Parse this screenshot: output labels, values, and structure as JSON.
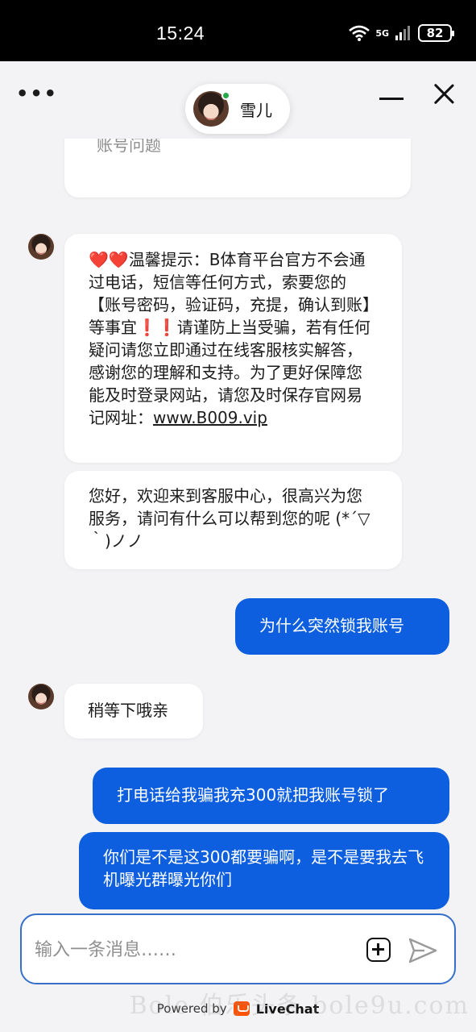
{
  "status_bar": {
    "time": "15:24",
    "network": "5G",
    "battery": "82"
  },
  "header": {
    "agent_name": "雪儿",
    "menu_icon": "more-horizontal-icon",
    "minimize_icon": "minimize-icon",
    "close_icon": "close-icon"
  },
  "chat": {
    "previous_card_text": "账号问题",
    "messages": [
      {
        "from": "agent",
        "parts": {
          "heart": "❤️❤️",
          "lines": "温馨提示：B体育平台官方不会通过电话，短信等任何方式，索要您的【账号密码，验证码，充提，确认到账】等事宜❗❗请谨防上当受骗，若有任何疑问请您立即通过在线客服核实解答，感谢您的理解和支持。为了更好保障您能及时登录网站，请您及时保存官网易记网址：",
          "link": "www.B009.vip"
        }
      },
      {
        "from": "agent",
        "text": "您好，欢迎来到客服中心，很高兴为您服务，请问有什么可以帮到您的呢 (*´▽｀)ノノ"
      },
      {
        "from": "user",
        "text": "为什么突然锁我账号"
      },
      {
        "from": "agent",
        "text": "稍等下哦亲"
      },
      {
        "from": "user",
        "text": "打电话给我骗我充300就把我账号锁了"
      },
      {
        "from": "user",
        "text": "你们是不是这300都要骗啊，是不是要我去飞机曝光群曝光你们"
      }
    ]
  },
  "composer": {
    "placeholder": "输入一条消息……",
    "add_icon": "plus-square-icon",
    "send_icon": "send-icon"
  },
  "footer": {
    "powered_by": "Powered by",
    "brand": "LiveChat"
  },
  "watermark": "Bole 伯乐头条 bole9u.com",
  "colors": {
    "accent": "#0d5fe0",
    "online": "#27a84a",
    "brand_logo": "#ff5100"
  }
}
